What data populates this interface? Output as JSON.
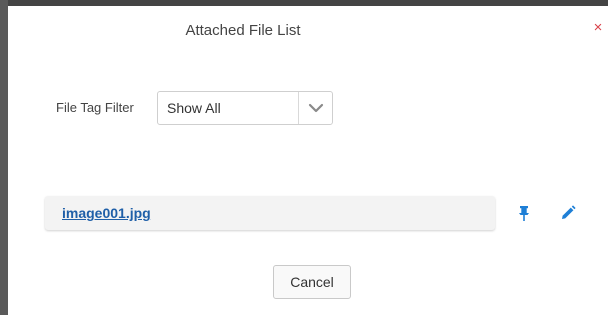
{
  "dialog": {
    "title": "Attached File List",
    "close_glyph": "×"
  },
  "filter": {
    "label": "File Tag Filter",
    "selected": "Show All"
  },
  "files": [
    {
      "name": "image001.jpg"
    }
  ],
  "actions": {
    "cancel_label": "Cancel"
  },
  "colors": {
    "accent": "#1f5fa8",
    "icon_blue": "#1e7fd6",
    "close_red": "#d9434b"
  },
  "icons": {
    "pin": "pin-icon",
    "edit": "pencil-icon",
    "dropdown": "chevron-down-icon"
  }
}
